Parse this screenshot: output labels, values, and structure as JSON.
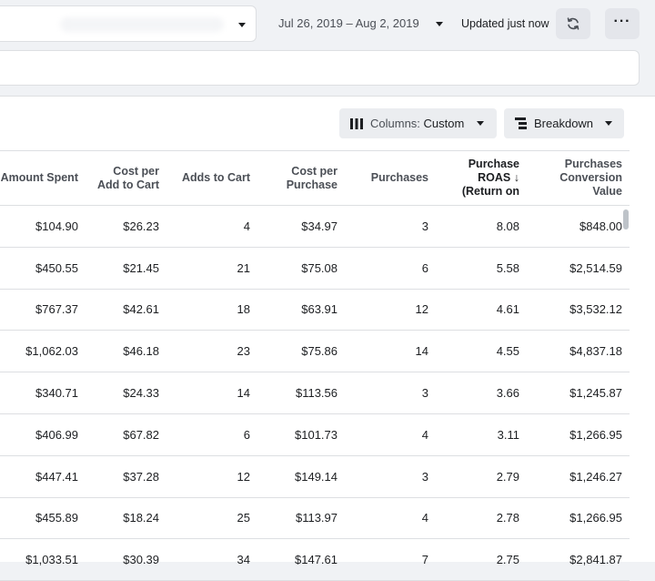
{
  "header": {
    "date_range": "Jul 26, 2019 – Aug 2, 2019",
    "updated_text": "Updated just now",
    "more_label": "···",
    "icons": {
      "account_caret": "chevron-down-icon",
      "refresh": "refresh-icon",
      "more": "more-icon"
    }
  },
  "toolbar": {
    "columns_prefix": "Columns:",
    "columns_value": "Custom",
    "breakdown_label": "Breakdown"
  },
  "table": {
    "columns": [
      [
        "Amount Spent"
      ],
      [
        "Cost per",
        "Add to Cart"
      ],
      [
        "Adds to Cart"
      ],
      [
        "Cost per",
        "Purchase"
      ],
      [
        "Purchases"
      ],
      [
        "Purchase",
        "ROAS ↓",
        "(Return on"
      ],
      [
        "Purchases",
        "Conversion",
        "Value"
      ]
    ],
    "rows": [
      [
        "$104.90",
        "$26.23",
        "4",
        "$34.97",
        "3",
        "8.08",
        "$848.00"
      ],
      [
        "$450.55",
        "$21.45",
        "21",
        "$75.08",
        "6",
        "5.58",
        "$2,514.59"
      ],
      [
        "$767.37",
        "$42.61",
        "18",
        "$63.91",
        "12",
        "4.61",
        "$3,532.12"
      ],
      [
        "$1,062.03",
        "$46.18",
        "23",
        "$75.86",
        "14",
        "4.55",
        "$4,837.18"
      ],
      [
        "$340.71",
        "$24.33",
        "14",
        "$113.56",
        "3",
        "3.66",
        "$1,245.87"
      ],
      [
        "$406.99",
        "$67.82",
        "6",
        "$101.73",
        "4",
        "3.11",
        "$1,266.95"
      ],
      [
        "$447.41",
        "$37.28",
        "12",
        "$149.14",
        "3",
        "2.79",
        "$1,246.27"
      ],
      [
        "$455.89",
        "$18.24",
        "25",
        "$113.97",
        "4",
        "2.78",
        "$1,266.95"
      ],
      [
        "$1,033.51",
        "$30.39",
        "34",
        "$147.61",
        "7",
        "2.75",
        "$2,841.87"
      ]
    ]
  }
}
